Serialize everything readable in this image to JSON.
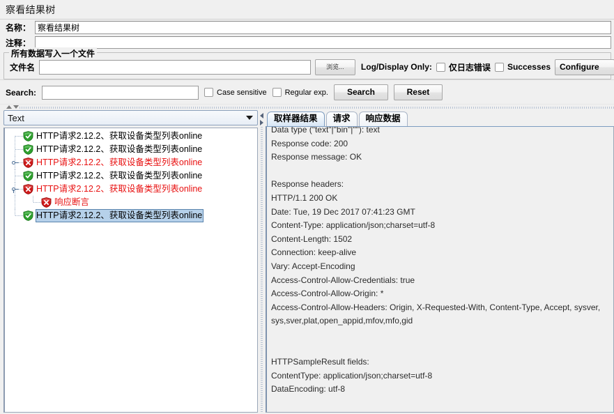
{
  "window": {
    "title": "察看结果树"
  },
  "form": {
    "name_label": "名称：",
    "name_value": "察看结果树",
    "comment_label": "注释：",
    "comment_value": ""
  },
  "file_group": {
    "title": "所有数据写入一个文件",
    "filename_label": "文件名",
    "filename_value": "",
    "browse_button": "浏览...",
    "log_display_label": "Log/Display Only:",
    "errors_checkbox_label": "仅日志错误",
    "errors_checked": false,
    "successes_checkbox_label": "Successes",
    "successes_checked": false,
    "configure_button": "Configure"
  },
  "search": {
    "label": "Search:",
    "value": "",
    "case_sensitive_label": "Case sensitive",
    "case_sensitive_checked": false,
    "regular_exp_label": "Regular exp.",
    "regular_exp_checked": false,
    "search_button": "Search",
    "reset_button": "Reset"
  },
  "renderer": {
    "selected": "Text"
  },
  "tree": {
    "nodes": [
      {
        "label": "HTTP请求2.12.2、获取设备类型列表online",
        "status": "success",
        "depth": 1,
        "selected": false,
        "handle": "none"
      },
      {
        "label": "HTTP请求2.12.2、获取设备类型列表online",
        "status": "success",
        "depth": 1,
        "selected": false,
        "handle": "none"
      },
      {
        "label": "HTTP请求2.12.2、获取设备类型列表online",
        "status": "failure",
        "depth": 1,
        "selected": false,
        "handle": "collapsed"
      },
      {
        "label": "HTTP请求2.12.2、获取设备类型列表online",
        "status": "success",
        "depth": 1,
        "selected": false,
        "handle": "none"
      },
      {
        "label": "HTTP请求2.12.2、获取设备类型列表online",
        "status": "failure",
        "depth": 1,
        "selected": false,
        "handle": "expanded"
      },
      {
        "label": "响应断言",
        "status": "failure",
        "depth": 2,
        "selected": false,
        "handle": "none"
      },
      {
        "label": "HTTP请求2.12.2、获取设备类型列表online",
        "status": "success",
        "depth": 1,
        "selected": true,
        "handle": "none"
      }
    ]
  },
  "result_tabs": [
    {
      "label": "取样器结果",
      "active": true
    },
    {
      "label": "请求",
      "active": false
    },
    {
      "label": "响应数据",
      "active": false
    }
  ],
  "sampler_result": {
    "lines": [
      "Data type (\"text\"|\"bin\"|\"\"): text",
      "Response code: 200",
      "Response message: OK",
      "",
      "Response headers:",
      "HTTP/1.1 200 OK",
      "Date: Tue, 19 Dec 2017 07:41:23 GMT",
      "Content-Type: application/json;charset=utf-8",
      "Content-Length: 1502",
      "Connection: keep-alive",
      "Vary: Accept-Encoding",
      "Access-Control-Allow-Credentials: true",
      "Access-Control-Allow-Origin: *",
      "Access-Control-Allow-Headers: Origin, X-Requested-With, Content-Type, Accept, sysver, sys,sver,plat,open_appid,mfov,mfo,gid",
      "",
      "",
      "HTTPSampleResult fields:",
      "ContentType: application/json;charset=utf-8",
      "DataEncoding: utf-8"
    ]
  },
  "colors": {
    "success": "#3aa33a",
    "failure": "#d11f1f",
    "failure_text": "#e81010",
    "selection_bg": "#b6d1ea",
    "panel_bg": "#f0f0f0"
  }
}
